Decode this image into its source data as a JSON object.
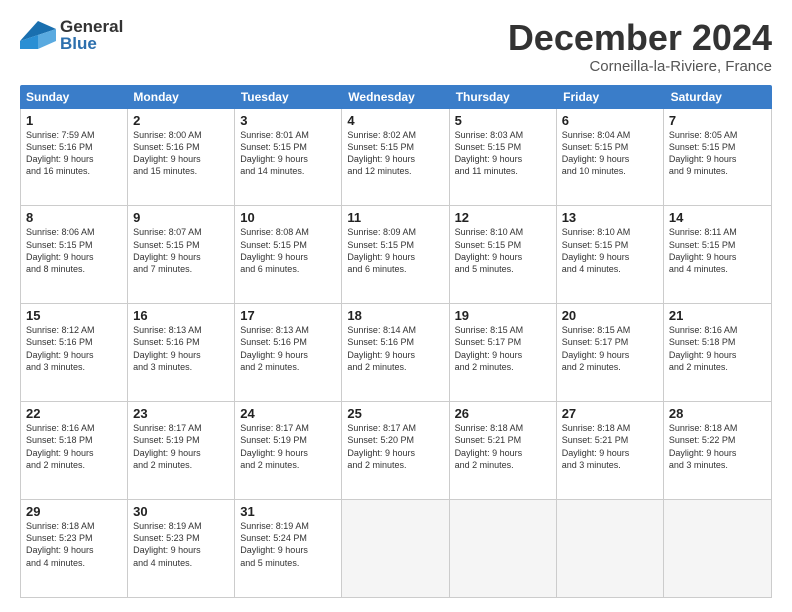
{
  "header": {
    "logo_general": "General",
    "logo_blue": "Blue",
    "month_title": "December 2024",
    "location": "Corneilla-la-Riviere, France"
  },
  "weekdays": [
    "Sunday",
    "Monday",
    "Tuesday",
    "Wednesday",
    "Thursday",
    "Friday",
    "Saturday"
  ],
  "rows": [
    [
      {
        "day": "1",
        "lines": [
          "Sunrise: 7:59 AM",
          "Sunset: 5:16 PM",
          "Daylight: 9 hours",
          "and 16 minutes."
        ]
      },
      {
        "day": "2",
        "lines": [
          "Sunrise: 8:00 AM",
          "Sunset: 5:16 PM",
          "Daylight: 9 hours",
          "and 15 minutes."
        ]
      },
      {
        "day": "3",
        "lines": [
          "Sunrise: 8:01 AM",
          "Sunset: 5:15 PM",
          "Daylight: 9 hours",
          "and 14 minutes."
        ]
      },
      {
        "day": "4",
        "lines": [
          "Sunrise: 8:02 AM",
          "Sunset: 5:15 PM",
          "Daylight: 9 hours",
          "and 12 minutes."
        ]
      },
      {
        "day": "5",
        "lines": [
          "Sunrise: 8:03 AM",
          "Sunset: 5:15 PM",
          "Daylight: 9 hours",
          "and 11 minutes."
        ]
      },
      {
        "day": "6",
        "lines": [
          "Sunrise: 8:04 AM",
          "Sunset: 5:15 PM",
          "Daylight: 9 hours",
          "and 10 minutes."
        ]
      },
      {
        "day": "7",
        "lines": [
          "Sunrise: 8:05 AM",
          "Sunset: 5:15 PM",
          "Daylight: 9 hours",
          "and 9 minutes."
        ]
      }
    ],
    [
      {
        "day": "8",
        "lines": [
          "Sunrise: 8:06 AM",
          "Sunset: 5:15 PM",
          "Daylight: 9 hours",
          "and 8 minutes."
        ]
      },
      {
        "day": "9",
        "lines": [
          "Sunrise: 8:07 AM",
          "Sunset: 5:15 PM",
          "Daylight: 9 hours",
          "and 7 minutes."
        ]
      },
      {
        "day": "10",
        "lines": [
          "Sunrise: 8:08 AM",
          "Sunset: 5:15 PM",
          "Daylight: 9 hours",
          "and 6 minutes."
        ]
      },
      {
        "day": "11",
        "lines": [
          "Sunrise: 8:09 AM",
          "Sunset: 5:15 PM",
          "Daylight: 9 hours",
          "and 6 minutes."
        ]
      },
      {
        "day": "12",
        "lines": [
          "Sunrise: 8:10 AM",
          "Sunset: 5:15 PM",
          "Daylight: 9 hours",
          "and 5 minutes."
        ]
      },
      {
        "day": "13",
        "lines": [
          "Sunrise: 8:10 AM",
          "Sunset: 5:15 PM",
          "Daylight: 9 hours",
          "and 4 minutes."
        ]
      },
      {
        "day": "14",
        "lines": [
          "Sunrise: 8:11 AM",
          "Sunset: 5:15 PM",
          "Daylight: 9 hours",
          "and 4 minutes."
        ]
      }
    ],
    [
      {
        "day": "15",
        "lines": [
          "Sunrise: 8:12 AM",
          "Sunset: 5:16 PM",
          "Daylight: 9 hours",
          "and 3 minutes."
        ]
      },
      {
        "day": "16",
        "lines": [
          "Sunrise: 8:13 AM",
          "Sunset: 5:16 PM",
          "Daylight: 9 hours",
          "and 3 minutes."
        ]
      },
      {
        "day": "17",
        "lines": [
          "Sunrise: 8:13 AM",
          "Sunset: 5:16 PM",
          "Daylight: 9 hours",
          "and 2 minutes."
        ]
      },
      {
        "day": "18",
        "lines": [
          "Sunrise: 8:14 AM",
          "Sunset: 5:16 PM",
          "Daylight: 9 hours",
          "and 2 minutes."
        ]
      },
      {
        "day": "19",
        "lines": [
          "Sunrise: 8:15 AM",
          "Sunset: 5:17 PM",
          "Daylight: 9 hours",
          "and 2 minutes."
        ]
      },
      {
        "day": "20",
        "lines": [
          "Sunrise: 8:15 AM",
          "Sunset: 5:17 PM",
          "Daylight: 9 hours",
          "and 2 minutes."
        ]
      },
      {
        "day": "21",
        "lines": [
          "Sunrise: 8:16 AM",
          "Sunset: 5:18 PM",
          "Daylight: 9 hours",
          "and 2 minutes."
        ]
      }
    ],
    [
      {
        "day": "22",
        "lines": [
          "Sunrise: 8:16 AM",
          "Sunset: 5:18 PM",
          "Daylight: 9 hours",
          "and 2 minutes."
        ]
      },
      {
        "day": "23",
        "lines": [
          "Sunrise: 8:17 AM",
          "Sunset: 5:19 PM",
          "Daylight: 9 hours",
          "and 2 minutes."
        ]
      },
      {
        "day": "24",
        "lines": [
          "Sunrise: 8:17 AM",
          "Sunset: 5:19 PM",
          "Daylight: 9 hours",
          "and 2 minutes."
        ]
      },
      {
        "day": "25",
        "lines": [
          "Sunrise: 8:17 AM",
          "Sunset: 5:20 PM",
          "Daylight: 9 hours",
          "and 2 minutes."
        ]
      },
      {
        "day": "26",
        "lines": [
          "Sunrise: 8:18 AM",
          "Sunset: 5:21 PM",
          "Daylight: 9 hours",
          "and 2 minutes."
        ]
      },
      {
        "day": "27",
        "lines": [
          "Sunrise: 8:18 AM",
          "Sunset: 5:21 PM",
          "Daylight: 9 hours",
          "and 3 minutes."
        ]
      },
      {
        "day": "28",
        "lines": [
          "Sunrise: 8:18 AM",
          "Sunset: 5:22 PM",
          "Daylight: 9 hours",
          "and 3 minutes."
        ]
      }
    ],
    [
      {
        "day": "29",
        "lines": [
          "Sunrise: 8:18 AM",
          "Sunset: 5:23 PM",
          "Daylight: 9 hours",
          "and 4 minutes."
        ]
      },
      {
        "day": "30",
        "lines": [
          "Sunrise: 8:19 AM",
          "Sunset: 5:23 PM",
          "Daylight: 9 hours",
          "and 4 minutes."
        ]
      },
      {
        "day": "31",
        "lines": [
          "Sunrise: 8:19 AM",
          "Sunset: 5:24 PM",
          "Daylight: 9 hours",
          "and 5 minutes."
        ]
      },
      {
        "day": "",
        "lines": []
      },
      {
        "day": "",
        "lines": []
      },
      {
        "day": "",
        "lines": []
      },
      {
        "day": "",
        "lines": []
      }
    ]
  ]
}
